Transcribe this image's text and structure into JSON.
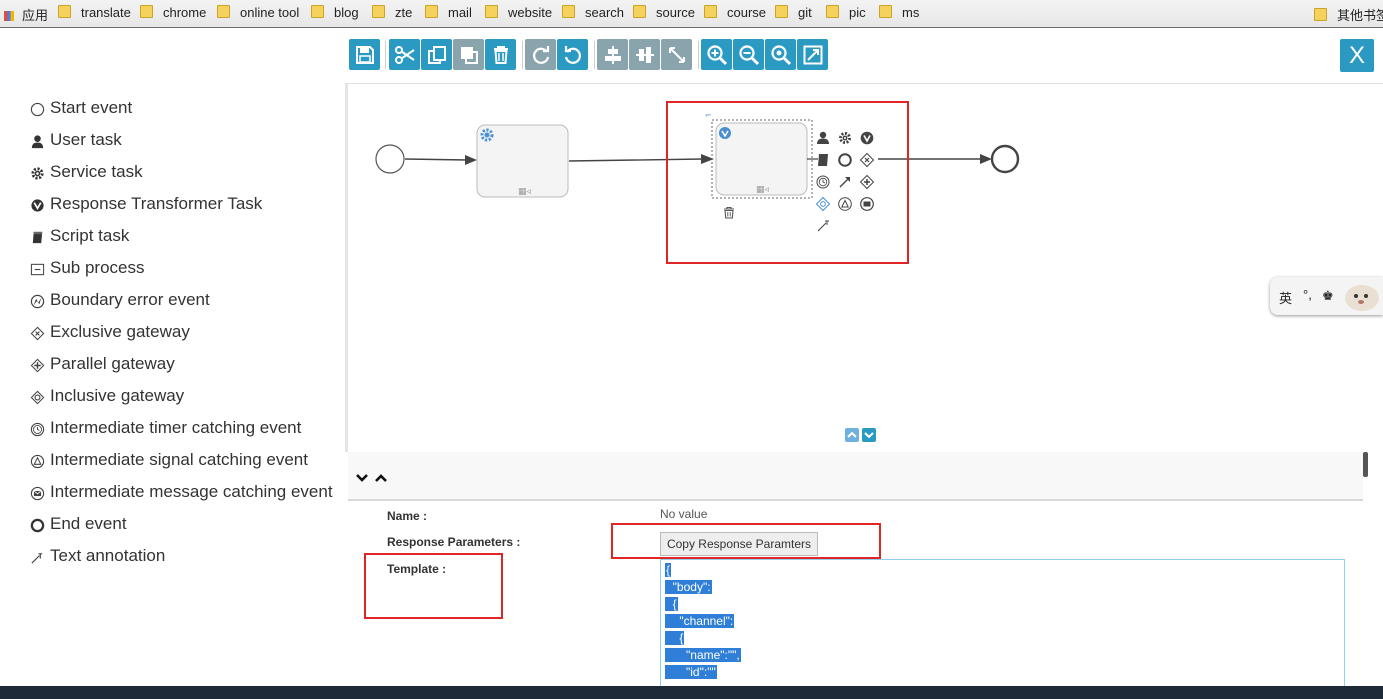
{
  "bookmarks": {
    "apps_label": "应用",
    "folders": [
      "translate",
      "chrome",
      "online tool",
      "blog",
      "zte",
      "mail",
      "website",
      "search",
      "source",
      "course",
      "git",
      "pic",
      "ms"
    ],
    "other_label": "其他书签"
  },
  "palette": [
    {
      "label": "Start event",
      "icon": "start-event-icon"
    },
    {
      "label": "User task",
      "icon": "user-icon"
    },
    {
      "label": "Service task",
      "icon": "gear-icon"
    },
    {
      "label": "Response Transformer Task",
      "icon": "transformer-icon"
    },
    {
      "label": "Script task",
      "icon": "script-icon"
    },
    {
      "label": "Sub process",
      "icon": "subprocess-icon"
    },
    {
      "label": "Boundary error event",
      "icon": "error-event-icon"
    },
    {
      "label": "Exclusive gateway",
      "icon": "exclusive-gateway-icon"
    },
    {
      "label": "Parallel gateway",
      "icon": "parallel-gateway-icon"
    },
    {
      "label": "Inclusive gateway",
      "icon": "inclusive-gateway-icon"
    },
    {
      "label": "Intermediate timer catching event",
      "icon": "timer-event-icon"
    },
    {
      "label": "Intermediate signal catching event",
      "icon": "signal-event-icon"
    },
    {
      "label": "Intermediate message catching event",
      "icon": "message-event-icon"
    },
    {
      "label": "End event",
      "icon": "end-event-icon"
    },
    {
      "label": "Text annotation",
      "icon": "annotation-icon"
    }
  ],
  "toolbar": {
    "close_label": "X",
    "buttons": [
      "save-icon",
      "cut-icon",
      "copy-icon",
      "paste-icon",
      "delete-icon",
      "redo-icon",
      "undo-icon",
      "align-horizontal-icon",
      "align-vertical-icon",
      "same-size-icon",
      "zoom-in-icon",
      "zoom-out-icon",
      "zoom-actual-icon",
      "zoom-fit-icon"
    ]
  },
  "properties": {
    "name_label": "Name :",
    "name_value": "No value",
    "response_label": "Response Parameters :",
    "copy_button": "Copy Response Paramters",
    "template_label": "Template :",
    "template_lines": [
      "{",
      "  \"body\":",
      "  {",
      "    \"channel\":",
      "    {",
      "      \"name\":\"\",",
      "      \"id\":\"\""
    ]
  },
  "ime": {
    "lang": "英",
    "punct": "°,"
  },
  "colors": {
    "accent": "#2b9ac2",
    "highlight": "#e02525",
    "selection": "#2f7fd8"
  }
}
